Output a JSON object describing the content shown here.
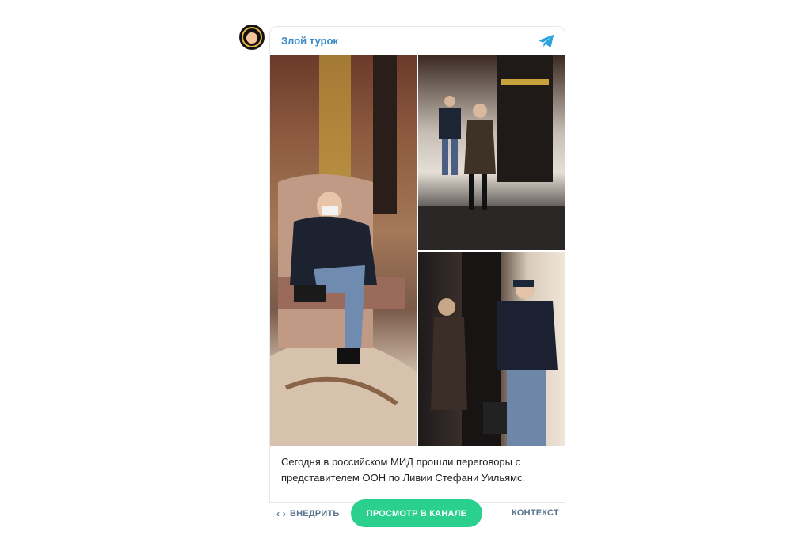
{
  "channel": {
    "name": "Злой турок"
  },
  "post": {
    "caption_line1": "Сегодня в российском МИД прошли переговоры с",
    "caption_line2": "представителем ООН по Ливии Стефани Уильямс."
  },
  "actions": {
    "embed_label": "ВНЕДРИТЬ",
    "embed_icon": "‹ ›",
    "view_label": "ПРОСМОТР В КАНАЛЕ",
    "context_label": "КОНТЕКСТ"
  },
  "colors": {
    "accent": "#3a8ac9",
    "button": "#2bd08e",
    "action_text": "#5d7690"
  },
  "icons": [
    "telegram-icon",
    "code-icon"
  ]
}
